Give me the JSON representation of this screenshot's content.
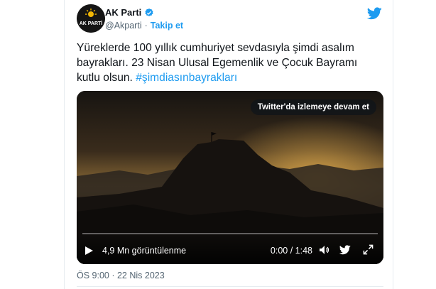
{
  "account": {
    "name": "AK Parti",
    "handle": "@Akparti",
    "separator": "·",
    "follow_label": "Takip et"
  },
  "tweet": {
    "text": "Yüreklerde 100 yıllık cumhuriyet sevdasıyla şimdi asalım bayrakları. 23 Nisan Ulusal Egemenlik ve Çocuk Bayramı kutlu olsun.",
    "hashtag": "#şimdiasınbayrakları"
  },
  "media": {
    "watch_label": "Twitter'da izlemeye devam et",
    "views": "4,9 Mn görüntülenme",
    "time": "0:00 / 1:48",
    "progress": 0
  },
  "meta": {
    "timestamp": "ÖS 9:00 · 22 Nis 2023"
  },
  "icons": {
    "avatar": "ak-parti-logo",
    "verified": "verified-badge-icon",
    "brand": "twitter-bird-icon",
    "play": "play-icon",
    "mute": "volume-icon",
    "twitter_small": "twitter-bird-icon",
    "expand": "expand-icon"
  },
  "colors": {
    "accent": "#1d9bf0",
    "text": "#0f1419",
    "secondary": "#536471"
  }
}
